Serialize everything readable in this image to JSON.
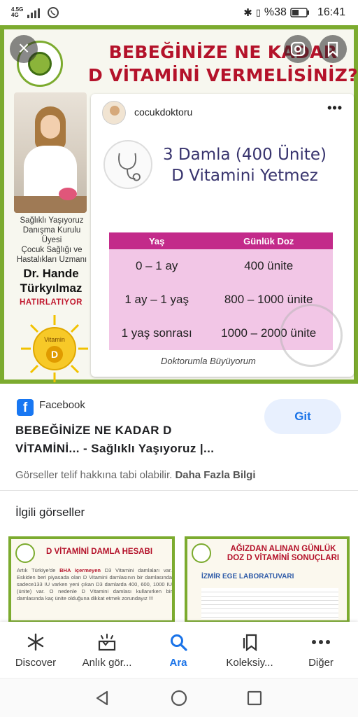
{
  "status_bar": {
    "network_top": "4.5G",
    "network_bottom": "4G",
    "battery": "%38",
    "time": "16:41"
  },
  "hero": {
    "title_line1": "BEBEĞİNİZE NE KADAR",
    "title_line2": "D VİTAMİNİ VERMELİSİNİZ?",
    "side_line1": "Sağlıklı Yaşıyoruz",
    "side_line2": "Danışma Kurulu",
    "side_line3": "Üyesi",
    "side_line4": "Çocuk Sağlığı ve",
    "side_line5": "Hastalıkları Uzmanı",
    "doctor_line1": "Dr. Hande",
    "doctor_line2": "Türkyılmaz",
    "remind": "HATIRLATIYOR",
    "sun_text": "Vitamin",
    "sun_letter": "D",
    "post": {
      "username": "cocukdoktoru",
      "more": "•••",
      "heading_line1": "3 Damla (400 Ünite)",
      "heading_line2": "D Vitamini Yetmez",
      "table_headers": [
        "Yaş",
        "Günlük Doz"
      ],
      "table_rows": [
        [
          "0 – 1 ay",
          "400 ünite"
        ],
        [
          "1 ay – 1 yaş",
          "800 – 1000 ünite"
        ],
        [
          "1 yaş sonrası",
          "1000 – 2000 ünite"
        ]
      ],
      "footer": "Doktorumla Büyüyorum"
    }
  },
  "result": {
    "source": "Facebook",
    "title_line1": "BEBEĞİNİZE NE KADAR D",
    "title_line2": "VİTAMİNİ... - Sağlıklı Yaşıyoruz |...",
    "visit_button": "Git",
    "copyright": "Görseller telif hakkına tabi olabilir.",
    "more_info": "Daha Fazla Bilgi"
  },
  "related": {
    "heading": "İlgili görseller",
    "thumb1": {
      "title": "D VİTAMİNİ DAMLA HESABI",
      "body_pre": "Artık Türkiye'de",
      "body_bold": "BHA içermeyen",
      "body_post": "D3 Vitamini damlaları var. Eskiden beri piyasada olan D Vitamini damlasının bir damlasında sadece133 IU varken yeni çıkan D3 damlarda 400, 600, 1000 IU (ünite) var. O nedenle D Vitamini damlası kullanırken bir damlasında kaç ünite olduğuna dikkat etmek zorundayız !!!"
    },
    "thumb2": {
      "title_line1": "AĞIZDAN ALINAN GÜNLÜK",
      "title_line2": "DOZ D VİTAMİNİ SONUÇLARI",
      "lab": "İZMİR EGE LABORATUVARI"
    }
  },
  "bottom_nav": {
    "items": [
      {
        "label": "Discover",
        "icon": "asterisk-icon"
      },
      {
        "label": "Anlık gör...",
        "icon": "updates-icon"
      },
      {
        "label": "Ara",
        "icon": "search-icon"
      },
      {
        "label": "Koleksiy...",
        "icon": "collections-icon"
      },
      {
        "label": "Diğer",
        "icon": "more-icon"
      }
    ],
    "active_index": 2
  },
  "colors": {
    "brand_green": "#7cab2f",
    "title_red": "#b4122a",
    "table_header": "#c32a8a",
    "table_cell": "#f2c6e6",
    "accent_blue": "#1a73e8"
  }
}
